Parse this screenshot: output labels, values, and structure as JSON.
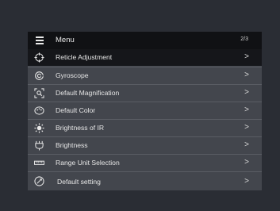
{
  "header": {
    "title": "Menu",
    "page_indicator": "2/3",
    "icon": "hamburger-icon"
  },
  "items": [
    {
      "label": "Reticle Adjustment",
      "icon": "crosshair-icon",
      "selected": true
    },
    {
      "label": "Gyroscope",
      "icon": "gyroscope-icon",
      "selected": false
    },
    {
      "label": "Default Magnification",
      "icon": "magnify-icon",
      "selected": false
    },
    {
      "label": "Default Color",
      "icon": "palette-icon",
      "selected": false
    },
    {
      "label": "Brightness of IR",
      "icon": "ir-brightness-icon",
      "selected": false
    },
    {
      "label": "Brightness",
      "icon": "brightness-icon",
      "selected": false
    },
    {
      "label": "Range Unit Selection",
      "icon": "ruler-icon",
      "selected": false
    },
    {
      "label": "Default setting",
      "icon": "reset-icon",
      "selected": false
    }
  ],
  "chevron": ">",
  "colors": {
    "background": "#2a2d34",
    "panel": "#43464d",
    "header": "#101114",
    "selected": "#15161a",
    "text": "#e6e6e6"
  }
}
